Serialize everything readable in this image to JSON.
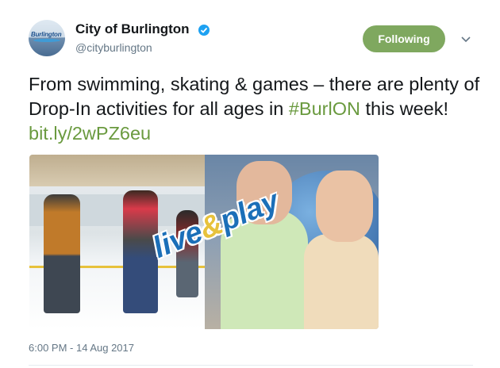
{
  "account": {
    "avatar_text": "Burlington",
    "name": "City of Burlington",
    "handle": "@cityburlington",
    "verified_icon": "verified-badge-icon"
  },
  "actions": {
    "follow_label": "Following",
    "menu_icon": "chevron-down-icon"
  },
  "tweet": {
    "text_before": "From swimming, skating & games – there are plenty of Drop-In activities for all ages in ",
    "hashtag": "#BurlON",
    "text_middle": " this week! ",
    "link": "bit.ly/2wPZ6eu",
    "timestamp": "6:00 PM - 14 Aug 2017"
  },
  "media": {
    "overlay_live": "live",
    "overlay_amp": "&",
    "overlay_play": "play"
  },
  "colors": {
    "follow_button": "#7fa85f",
    "link": "#6a9a3f",
    "verified": "#1da1f2"
  }
}
